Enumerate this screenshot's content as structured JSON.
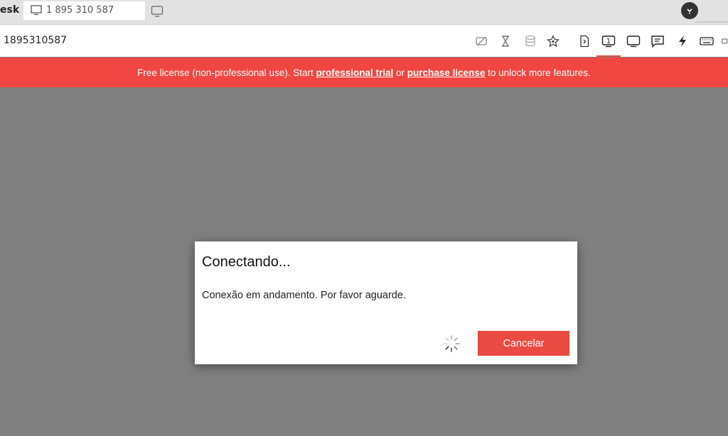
{
  "tabbar": {
    "app_name": "esk",
    "active_tab": {
      "label": "1 895 310 587",
      "icon": "monitor-icon"
    },
    "new_tab_icon": "monitor-icon",
    "account_icon": "account-icon"
  },
  "toolbar": {
    "remote_id": "1895310587",
    "icons": [
      "hide-icon",
      "hourglass-icon",
      "database-icon",
      "star-icon",
      "file-icon",
      "display-1-icon",
      "monitor-icon",
      "chat-icon",
      "lightning-icon",
      "keyboard-icon",
      "more-icon"
    ]
  },
  "banner": {
    "text_start": "Free license (non-professional use). Start ",
    "trial_link": "professional trial",
    "text_or": " or ",
    "purchase_link": "purchase license",
    "text_end": " to unlock more features.",
    "color": "#f04641"
  },
  "dialog": {
    "title": "Conectando...",
    "message": "Conexão em andamento. Por favor aguarde.",
    "cancel_label": "Cancelar",
    "accent": "#e94a41"
  }
}
